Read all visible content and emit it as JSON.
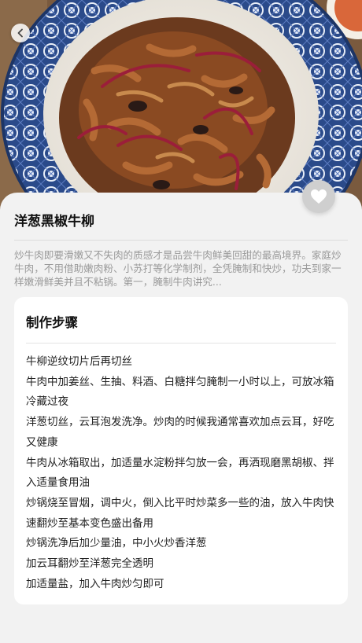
{
  "recipe": {
    "title": "洋葱黑椒牛柳",
    "intro": "炒牛肉即要滑嫩又不失肉的质感才是品尝牛肉鲜美回甜的最高境界。家庭炒牛肉，不用借助嫩肉粉、小苏打等化学制剂，全凭腌制和快炒，功夫到家一样嫩滑鲜美并且不粘锅。第一，腌制牛肉讲究..."
  },
  "steps_card": {
    "title": "制作步骤",
    "steps": [
      "牛柳逆纹切片后再切丝",
      "牛肉中加姜丝、生抽、料酒、白糖拌匀腌制一小时以上，可放冰箱冷藏过夜",
      "洋葱切丝，云耳泡发洗净。炒肉的时候我通常喜欢加点云耳，好吃又健康",
      "牛肉从冰箱取出，加适量水淀粉拌匀放一会，再洒现磨黑胡椒、拌入适量食用油",
      "炒锅烧至冒烟，调中火，倒入比平时炒菜多一些的油，放入牛肉快速翻炒至基本变色盛出备用",
      "炒锅洗净后加少量油，中小火炒香洋葱",
      "加云耳翻炒至洋葱完全透明",
      "加适量盐，加入牛肉炒匀即可"
    ]
  },
  "icons": {
    "back": "chevron-left-icon",
    "favorite": "heart-icon"
  },
  "colors": {
    "background": "#f2f2f2",
    "card": "#ffffff",
    "favorite_button": "#cfcfcf"
  }
}
